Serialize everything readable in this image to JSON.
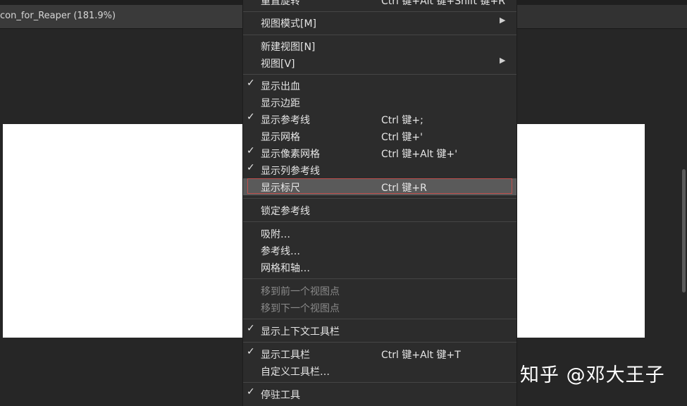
{
  "document": {
    "tab_title": "con_for_Reaper (181.9%)"
  },
  "watermark": "知乎 @邓大王子",
  "menu": {
    "items": [
      {
        "label": "重置旋转",
        "shortcut": "Ctrl 键+Alt 键+Shift 键+R",
        "checked": false
      },
      {
        "label": "视图模式[M]",
        "shortcut": "",
        "checked": false,
        "submenu": true
      },
      {
        "label": "新建视图[N]",
        "shortcut": "",
        "checked": false
      },
      {
        "label": "视图[V]",
        "shortcut": "",
        "checked": false,
        "submenu": true
      },
      {
        "label": "显示出血",
        "shortcut": "",
        "checked": true
      },
      {
        "label": "显示边距",
        "shortcut": "",
        "checked": false
      },
      {
        "label": "显示参考线",
        "shortcut": "Ctrl 键+;",
        "checked": true
      },
      {
        "label": "显示网格",
        "shortcut": "Ctrl 键+'",
        "checked": false
      },
      {
        "label": "显示像素网格",
        "shortcut": "Ctrl 键+Alt 键+'",
        "checked": true
      },
      {
        "label": "显示列参考线",
        "shortcut": "",
        "checked": true
      },
      {
        "label": "显示标尺",
        "shortcut": "Ctrl 键+R",
        "checked": false,
        "highlighted": true
      },
      {
        "label": "锁定参考线",
        "shortcut": "",
        "checked": false
      },
      {
        "label": "吸附…",
        "shortcut": "",
        "checked": false
      },
      {
        "label": "参考线…",
        "shortcut": "",
        "checked": false
      },
      {
        "label": "网格和轴…",
        "shortcut": "",
        "checked": false
      },
      {
        "label": "移到前一个视图点",
        "shortcut": "",
        "checked": false,
        "disabled": true
      },
      {
        "label": "移到下一个视图点",
        "shortcut": "",
        "checked": false,
        "disabled": true
      },
      {
        "label": "显示上下文工具栏",
        "shortcut": "",
        "checked": true
      },
      {
        "label": "显示工具栏",
        "shortcut": "Ctrl 键+Alt 键+T",
        "checked": true
      },
      {
        "label": "自定义工具栏…",
        "shortcut": "",
        "checked": false
      },
      {
        "label": "停驻工具",
        "shortcut": "",
        "checked": true
      }
    ],
    "check_glyph": "✓",
    "arrow_glyph": "▶"
  }
}
